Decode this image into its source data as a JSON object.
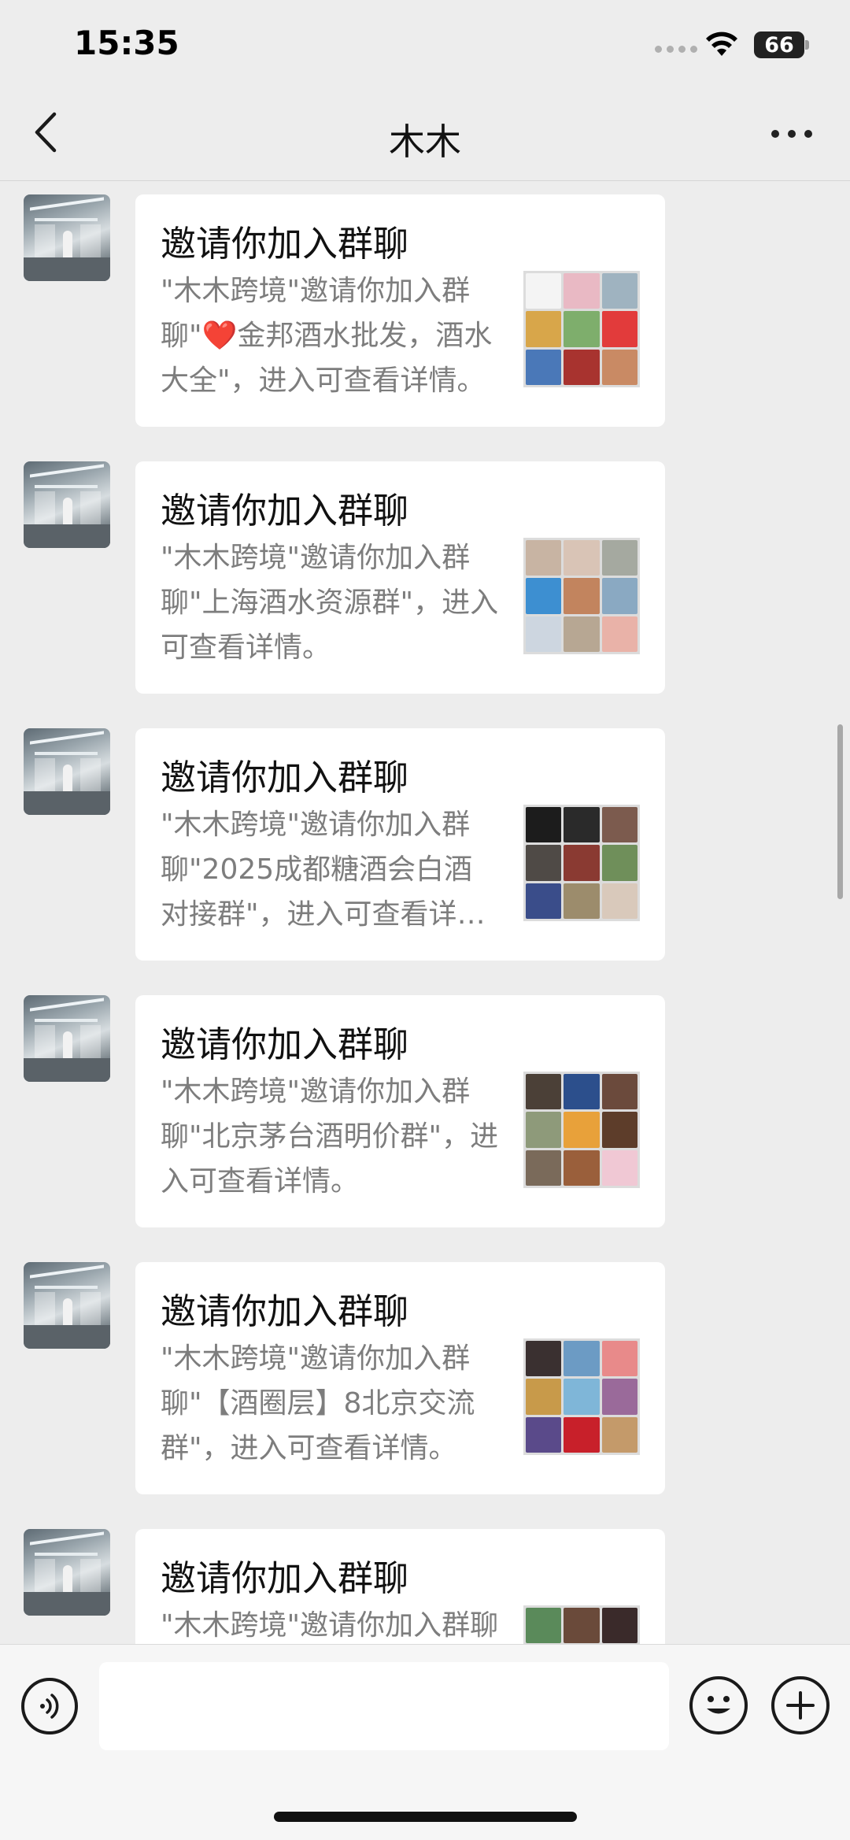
{
  "status_bar": {
    "time": "15:35",
    "battery": "66"
  },
  "nav": {
    "title": "木木"
  },
  "messages": [
    {
      "title": "邀请你加入群聊",
      "desc_before": "\"木木跨境\"邀请你加入群聊\"",
      "has_heart": true,
      "desc_after": "金邦酒水批发，酒水大全\"，进入可查看详情。",
      "thumb_colors": [
        "#f4f4f4",
        "#e9b9c4",
        "#9fb3c0",
        "#d8a64a",
        "#7eae6c",
        "#e23b3b",
        "#4a78b8",
        "#a8332f",
        "#c98a64"
      ]
    },
    {
      "title": "邀请你加入群聊",
      "desc_before": "\"木木跨境\"邀请你加入群聊\"上海酒水资源群\"，进入可查看详情。",
      "has_heart": false,
      "desc_after": "",
      "thumb_colors": [
        "#c8b4a3",
        "#d9c4b6",
        "#a5a9a0",
        "#3d8fd1",
        "#c2845e",
        "#8aa9c2",
        "#cdd6e0",
        "#b7a793",
        "#e9b2a8"
      ]
    },
    {
      "title": "邀请你加入群聊",
      "desc_before": "\"木木跨境\"邀请你加入群聊\"2025成都糖酒会白酒对接群\"，进入可查看详情。",
      "has_heart": false,
      "desc_after": "",
      "thumb_colors": [
        "#1c1c1c",
        "#2a2a2a",
        "#7c5b4e",
        "#4f4a46",
        "#8a3a32",
        "#6f8f5a",
        "#3a4d8a",
        "#9c8c6c",
        "#d9c9bb"
      ]
    },
    {
      "title": "邀请你加入群聊",
      "desc_before": "\"木木跨境\"邀请你加入群聊\"北京茅台酒明价群\"，进入可查看详情。",
      "has_heart": false,
      "desc_after": "",
      "thumb_colors": [
        "#4b4037",
        "#2c4f8c",
        "#6b4a3c",
        "#8e9a7a",
        "#e8a13a",
        "#5d3d2a",
        "#7a6a5a",
        "#9a5f3b",
        "#f0c8d4"
      ]
    },
    {
      "title": "邀请你加入群聊",
      "desc_before": "\"木木跨境\"邀请你加入群聊\"【酒圈层】8北京交流群\"，进入可查看详情。",
      "has_heart": false,
      "desc_after": "",
      "thumb_colors": [
        "#3a3030",
        "#6c9bc4",
        "#e88a8a",
        "#c89a4a",
        "#7fb6d8",
        "#9a6a9a",
        "#5a4a8a",
        "#c8202a",
        "#c49a6a"
      ]
    },
    {
      "title": "邀请你加入群聊",
      "desc_before": "\"木木跨境\"邀请你加入群聊",
      "has_heart": false,
      "desc_after": "",
      "thumb_colors": [
        "#5a8a5a",
        "#6a4a3a",
        "#3a2a2a",
        "#dcdcdc",
        "#dcdcdc",
        "#dcdcdc",
        "#dcdcdc",
        "#dcdcdc",
        "#dcdcdc"
      ]
    }
  ],
  "input": {
    "placeholder": ""
  },
  "colors": {
    "background": "#ededed",
    "card": "#ffffff",
    "secondary_text": "#7d7d7d",
    "heart": "#e2233b"
  },
  "icons": [
    "back-icon",
    "more-icon",
    "voice-icon",
    "emoji-icon",
    "plus-icon",
    "wifi-icon",
    "signal-icon",
    "battery-icon"
  ]
}
